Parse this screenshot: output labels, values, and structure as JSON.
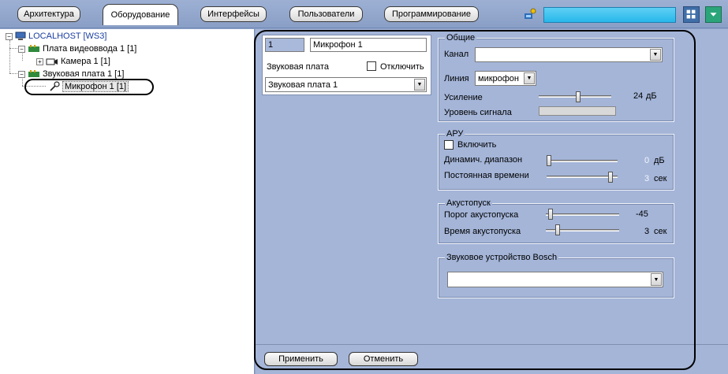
{
  "tabs": [
    {
      "label": "Архитектура"
    },
    {
      "label": "Оборудование"
    },
    {
      "label": "Интерфейсы"
    },
    {
      "label": "Пользователи"
    },
    {
      "label": "Программирование"
    }
  ],
  "tree": {
    "root": "LOCALHOST [WS3]",
    "video_board": "Плата видеоввода 1 [1]",
    "camera": "Камера 1 [1]",
    "sound_board": "Звуковая плата 1 [1]",
    "microphone": "Микрофон 1 [1]"
  },
  "header": {
    "id": "1",
    "name": "Микрофон 1",
    "sound_board_label": "Звуковая плата",
    "disable_label": "Отключить",
    "sound_board_value": "Звуковая плата 1"
  },
  "general": {
    "title": "Общие",
    "channel_label": "Канал",
    "channel_value": "",
    "line_label": "Линия",
    "line_value": "микрофон",
    "gain_label": "Усиление",
    "gain_value": "24",
    "gain_unit": "дБ",
    "gain_level": 0.55,
    "signal_label": "Уровень сигнала"
  },
  "agc": {
    "title": "АРУ",
    "enable_label": "Включить",
    "range_label": "Динамич. диапазон",
    "range_value": "0",
    "range_unit": "дБ",
    "range_level": 0.0,
    "time_label": "Постоянная времени",
    "time_value": "3",
    "time_unit": "сек",
    "time_level": 0.93
  },
  "vox": {
    "title": "Акустопуск",
    "threshold_label": "Порог акустопуска",
    "threshold_value": "-45",
    "threshold_level": 0.03,
    "time_label": "Время акустопуска",
    "time_value": "3",
    "time_unit": "сек",
    "time_level": 0.14
  },
  "bosch": {
    "title": "Звуковое устройство Bosch",
    "value": ""
  },
  "buttons": {
    "apply": "Применить",
    "cancel": "Отменить"
  }
}
